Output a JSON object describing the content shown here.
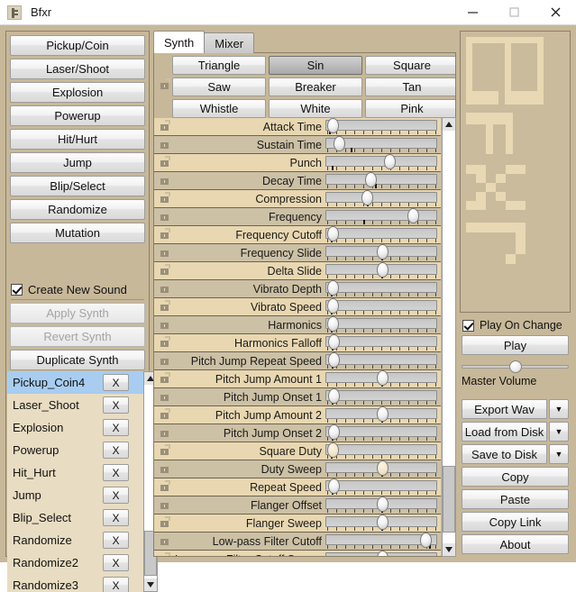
{
  "window": {
    "title": "Bfxr",
    "icon": "app-icon",
    "controls": {
      "minimize": "minimize-icon",
      "maximize": "maximize-icon",
      "close": "close-icon"
    }
  },
  "sidebar": {
    "generators": [
      "Pickup/Coin",
      "Laser/Shoot",
      "Explosion",
      "Powerup",
      "Hit/Hurt",
      "Jump",
      "Blip/Select",
      "Randomize",
      "Mutation"
    ],
    "create_new_sound": {
      "label": "Create New Sound",
      "checked": true
    },
    "actions": [
      {
        "label": "Apply Synth",
        "enabled": false
      },
      {
        "label": "Revert Synth",
        "enabled": false
      },
      {
        "label": "Duplicate Synth",
        "enabled": true
      }
    ],
    "sound_list": {
      "delete_label": "X",
      "items": [
        {
          "name": "Pickup_Coin4",
          "selected": true
        },
        {
          "name": "Laser_Shoot",
          "selected": false
        },
        {
          "name": "Explosion",
          "selected": false
        },
        {
          "name": "Powerup",
          "selected": false
        },
        {
          "name": "Hit_Hurt",
          "selected": false
        },
        {
          "name": "Jump",
          "selected": false
        },
        {
          "name": "Blip_Select",
          "selected": false
        },
        {
          "name": "Randomize",
          "selected": false
        },
        {
          "name": "Randomize2",
          "selected": false
        },
        {
          "name": "Randomize3",
          "selected": false
        }
      ]
    }
  },
  "center": {
    "tabs": [
      {
        "label": "Synth",
        "active": true
      },
      {
        "label": "Mixer",
        "active": false
      }
    ],
    "wave_types": [
      {
        "label": "Triangle",
        "selected": false
      },
      {
        "label": "Sin",
        "selected": true
      },
      {
        "label": "Square",
        "selected": false
      },
      {
        "label": "Saw",
        "selected": false
      },
      {
        "label": "Breaker",
        "selected": false
      },
      {
        "label": "Tan",
        "selected": false
      },
      {
        "label": "Whistle",
        "selected": false
      },
      {
        "label": "White",
        "selected": false
      },
      {
        "label": "Pink",
        "selected": false
      }
    ],
    "parameters": [
      {
        "label": "Attack Time",
        "value": 0.02,
        "origin": 0.02,
        "tan": false
      },
      {
        "label": "Sustain Time",
        "value": 0.08,
        "origin": 0.22,
        "tan": false
      },
      {
        "label": "Punch",
        "value": 0.59,
        "origin": 0.04,
        "tan": false
      },
      {
        "label": "Decay Time",
        "value": 0.4,
        "origin": 0.45,
        "tan": false
      },
      {
        "label": "Compression",
        "value": 0.36,
        "origin": 0.37,
        "tan": false
      },
      {
        "label": "Frequency",
        "value": 0.82,
        "origin": 0.34,
        "tan": false
      },
      {
        "label": "Frequency Cutoff",
        "value": 0.02,
        "origin": 0.03,
        "tan": false
      },
      {
        "label": "Frequency Slide",
        "value": 0.51,
        "origin": 0.51,
        "tan": false
      },
      {
        "label": "Delta Slide",
        "value": 0.51,
        "origin": 0.51,
        "tan": false
      },
      {
        "label": "Vibrato Depth",
        "value": 0.02,
        "origin": 0.03,
        "tan": false
      },
      {
        "label": "Vibrato Speed",
        "value": 0.02,
        "origin": 0.03,
        "tan": false
      },
      {
        "label": "Harmonics",
        "value": 0.02,
        "origin": 0.03,
        "tan": false
      },
      {
        "label": "Harmonics Falloff",
        "value": 0.03,
        "origin": 0.04,
        "tan": false
      },
      {
        "label": "Pitch Jump Repeat Speed",
        "value": 0.03,
        "origin": 0.04,
        "tan": false
      },
      {
        "label": "Pitch Jump Amount 1",
        "value": 0.51,
        "origin": 0.51,
        "tan": false
      },
      {
        "label": "Pitch Jump Onset 1",
        "value": 0.03,
        "origin": 0.04,
        "tan": false
      },
      {
        "label": "Pitch Jump Amount 2",
        "value": 0.51,
        "origin": 0.51,
        "tan": false
      },
      {
        "label": "Pitch Jump Onset 2",
        "value": 0.03,
        "origin": 0.04,
        "tan": false
      },
      {
        "label": "Square Duty",
        "value": 0.02,
        "origin": 0.03,
        "tan": true
      },
      {
        "label": "Duty Sweep",
        "value": 0.51,
        "origin": 0.51,
        "tan": true
      },
      {
        "label": "Repeat Speed",
        "value": 0.03,
        "origin": 0.04,
        "tan": false
      },
      {
        "label": "Flanger Offset",
        "value": 0.51,
        "origin": 0.51,
        "tan": false
      },
      {
        "label": "Flanger Sweep",
        "value": 0.51,
        "origin": 0.51,
        "tan": false
      },
      {
        "label": "Low-pass Filter Cutoff",
        "value": 0.95,
        "origin": 0.96,
        "tan": false
      },
      {
        "label": "Low-pass Filter Cutoff Sweep",
        "value": 0.51,
        "origin": 0.51,
        "tan": false
      }
    ],
    "lock_icon": "unlocked-padlock-icon",
    "scrollbar": {
      "up": "scroll-up-arrow-icon",
      "down": "scroll-down-arrow-icon"
    }
  },
  "right": {
    "logo": "bfxr-logo",
    "play_on_change": {
      "label": "Play On Change",
      "checked": true
    },
    "play_label": "Play",
    "master_volume": {
      "label": "Master Volume",
      "value": 0.5
    },
    "buttons": [
      {
        "label": "Export Wav",
        "dropdown": true,
        "caret": "▼"
      },
      {
        "label": "Load from Disk",
        "dropdown": true,
        "caret": "▼"
      },
      {
        "label": "Save to Disk",
        "dropdown": true,
        "caret": "▼"
      },
      {
        "label": "Copy",
        "dropdown": false,
        "caret": ""
      },
      {
        "label": "Paste",
        "dropdown": false,
        "caret": ""
      },
      {
        "label": "Copy Link",
        "dropdown": false,
        "caret": ""
      },
      {
        "label": "About",
        "dropdown": false,
        "caret": ""
      }
    ]
  },
  "colors": {
    "chrome": "#c7b899",
    "row_light": "#e8d7b0",
    "row_dark": "#ccc0a5",
    "selection": "#a8cdf0",
    "logo_bg": "#c9bb9c",
    "logo_fg": "#e8d9b4"
  }
}
